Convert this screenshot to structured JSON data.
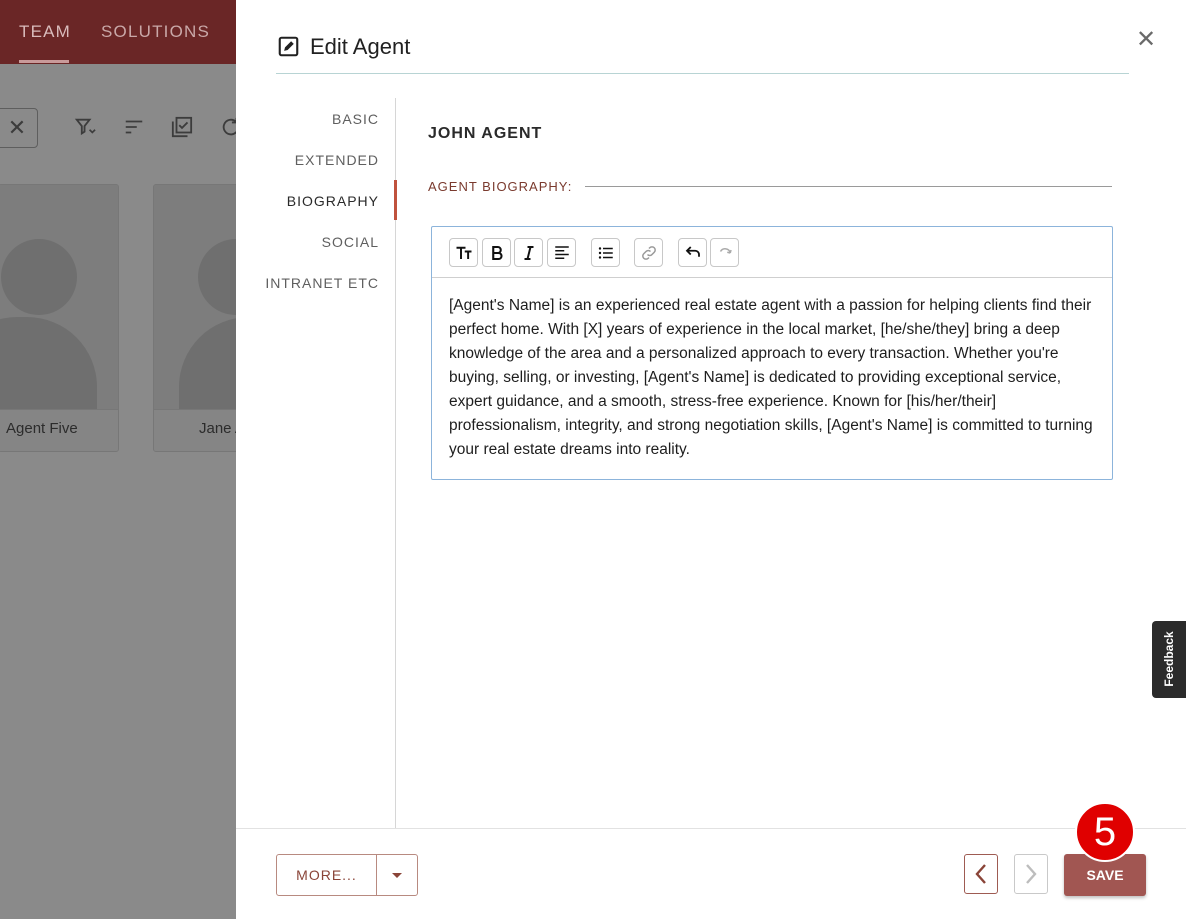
{
  "background": {
    "tabs": [
      {
        "label": "TEAM",
        "active": true
      },
      {
        "label": "SOLUTIONS",
        "active": false
      }
    ],
    "cards": [
      {
        "name": "Agent Five"
      },
      {
        "name": "Jane A"
      }
    ]
  },
  "dialog": {
    "title": "Edit Agent",
    "nav": [
      {
        "label": "BASIC",
        "active": false
      },
      {
        "label": "EXTENDED",
        "active": false
      },
      {
        "label": "BIOGRAPHY",
        "active": true
      },
      {
        "label": "SOCIAL",
        "active": false
      },
      {
        "label": "INTRANET ETC",
        "active": false
      }
    ],
    "agent_name": "JOHN AGENT",
    "section_label": "AGENT BIOGRAPHY:",
    "editor": {
      "toolbar": [
        "text-size-icon",
        "bold-icon",
        "italic-icon",
        "align-left-icon",
        "bulleted-list-icon",
        "link-icon",
        "undo-icon",
        "redo-icon"
      ],
      "content": "[Agent's Name] is an experienced real estate agent with a passion for helping clients find their perfect home. With [X] years of experience in the local market, [he/she/they] bring a deep knowledge of the area and a personalized approach to every transaction. Whether you're buying, selling, or investing, [Agent's Name] is dedicated to providing exceptional service, expert guidance, and a smooth, stress-free experience. Known for [his/her/their] professionalism, integrity, and strong negotiation skills, [Agent's Name] is committed to turning your real estate dreams into reality."
    },
    "feedback_label": "Feedback",
    "footer": {
      "more_label": "MORE...",
      "save_label": "SAVE"
    }
  },
  "step_badge": "5",
  "colors": {
    "accent": "#a15652",
    "active_nav_bar": "#c0523d",
    "topbar": "#6a2626"
  }
}
